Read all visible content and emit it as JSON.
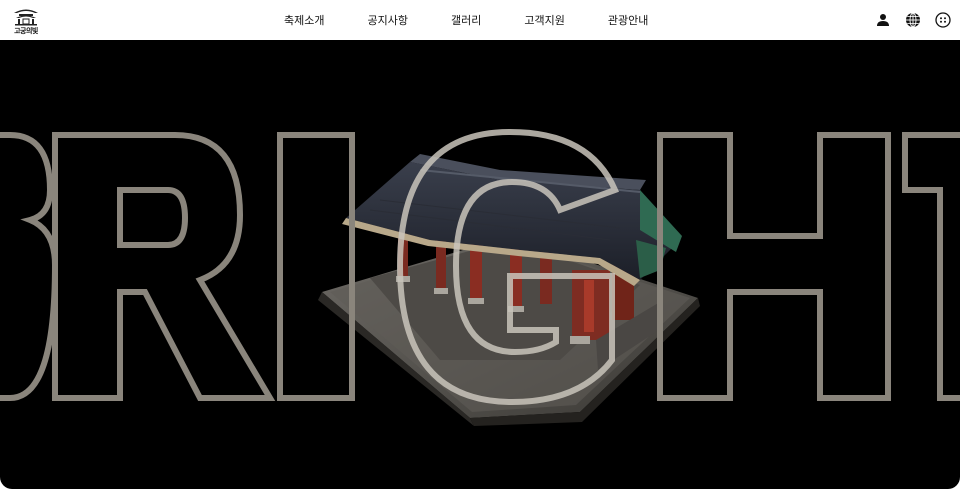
{
  "header": {
    "logo_text": "고궁의빛",
    "nav": [
      {
        "label": "축제소개"
      },
      {
        "label": "공지사항"
      },
      {
        "label": "갤러리"
      },
      {
        "label": "고객지원"
      },
      {
        "label": "관광안내"
      }
    ],
    "icons": [
      "user-icon",
      "globe-icon",
      "menu-dots-icon"
    ]
  },
  "hero": {
    "text": "BRIGHT",
    "outline_color": "#8a857c",
    "background": "#000000"
  }
}
